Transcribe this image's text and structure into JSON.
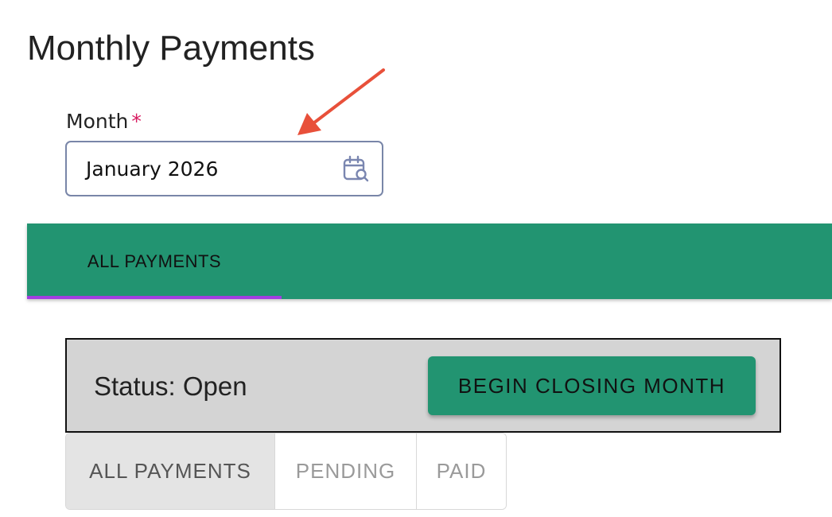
{
  "page": {
    "title": "Monthly Payments"
  },
  "month_field": {
    "label": "Month",
    "required_marker": "*",
    "value": "January 2026",
    "icon": "calendar-search-icon"
  },
  "tab_bar": {
    "active_tab": "ALL PAYMENTS",
    "color": "#229471",
    "indicator_color": "#a23de0"
  },
  "status_panel": {
    "status_text": "Status: Open",
    "action_button": "BEGIN CLOSING MONTH"
  },
  "filters": [
    {
      "label": "ALL PAYMENTS",
      "active": true
    },
    {
      "label": "PENDING",
      "active": false
    },
    {
      "label": "PAID",
      "active": false
    }
  ],
  "annotation": {
    "icon": "red-arrow-icon",
    "color": "#e8503a"
  }
}
